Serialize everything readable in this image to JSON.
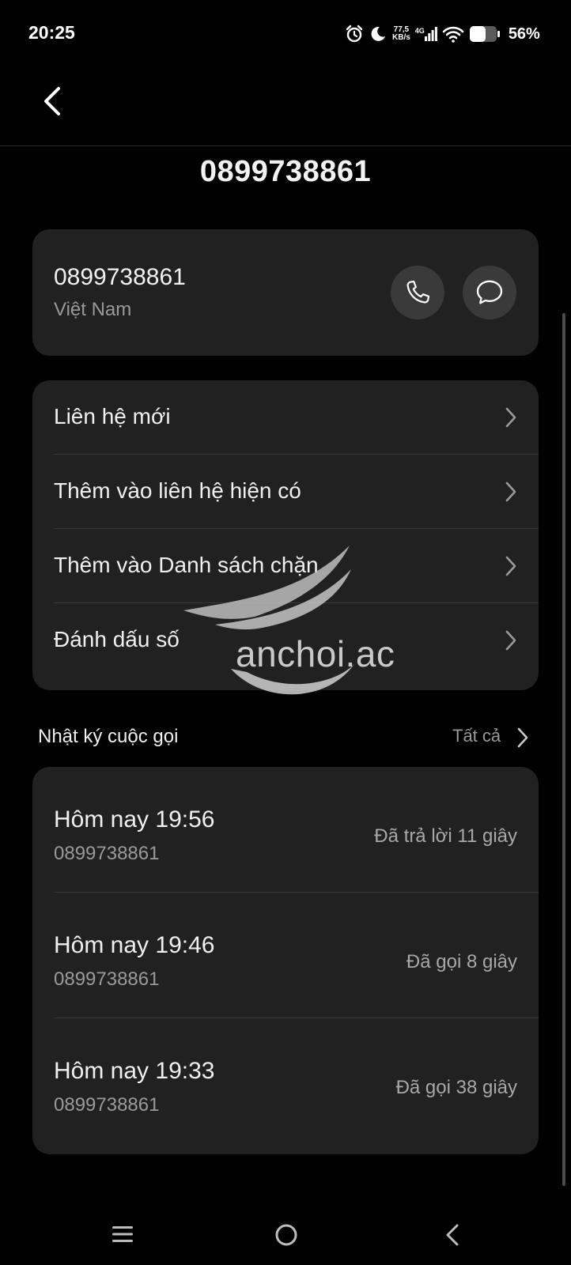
{
  "status_bar": {
    "time": "20:25",
    "speed_value": "77,5",
    "speed_unit": "KB/s",
    "network": "4G",
    "battery": "56%"
  },
  "header": {
    "title": "0899738861"
  },
  "contact_card": {
    "number": "0899738861",
    "country": "Việt Nam"
  },
  "actions": [
    {
      "label": "Liên hệ mới"
    },
    {
      "label": "Thêm vào liên hệ hiện có"
    },
    {
      "label": "Thêm vào Danh sách chặn"
    },
    {
      "label": "Đánh dấu số"
    }
  ],
  "call_log": {
    "title": "Nhật ký cuộc gọi",
    "see_all": "Tất cả",
    "entries": [
      {
        "time": "Hôm nay 19:56",
        "number": "0899738861",
        "status": "Đã trả lời 11 giây"
      },
      {
        "time": "Hôm nay 19:46",
        "number": "0899738861",
        "status": "Đã gọi 8 giây"
      },
      {
        "time": "Hôm nay 19:33",
        "number": "0899738861",
        "status": "Đã gọi 38 giây"
      }
    ]
  },
  "watermark": {
    "text": "anchoi.ac"
  },
  "colors": {
    "background": "#000000",
    "card": "#212121",
    "button": "#3a3a3a",
    "text_primary": "#f0f0f0",
    "text_secondary": "#9a9a9a"
  },
  "icons": [
    "alarm-icon",
    "moon-icon",
    "signal-icon",
    "wifi-icon",
    "battery-icon",
    "back-arrow-icon",
    "phone-icon",
    "message-icon",
    "chevron-right-icon",
    "menu-icon",
    "home-icon"
  ]
}
